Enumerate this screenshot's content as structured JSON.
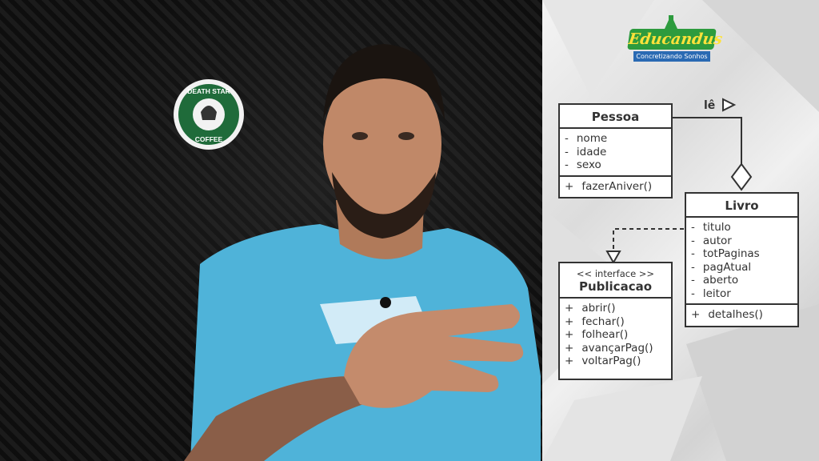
{
  "logo": {
    "name": "Educandus",
    "tagline": "Concretizando Sonhos"
  },
  "sticker": {
    "line1": "DEATH STAR",
    "line2": "COFFEE"
  },
  "diagram": {
    "association_label": "lê",
    "pessoa": {
      "title": "Pessoa",
      "attributes": [
        {
          "vis": "-",
          "name": "nome"
        },
        {
          "vis": "-",
          "name": "idade"
        },
        {
          "vis": "-",
          "name": "sexo"
        }
      ],
      "methods": [
        {
          "vis": "+",
          "name": "fazerAniver()"
        }
      ]
    },
    "livro": {
      "title": "Livro",
      "attributes": [
        {
          "vis": "-",
          "name": "titulo"
        },
        {
          "vis": "-",
          "name": "autor"
        },
        {
          "vis": "-",
          "name": "totPaginas"
        },
        {
          "vis": "-",
          "name": "pagAtual"
        },
        {
          "vis": "-",
          "name": "aberto"
        },
        {
          "vis": "-",
          "name": "leitor"
        }
      ],
      "methods": [
        {
          "vis": "+",
          "name": "detalhes()"
        }
      ]
    },
    "publicacao": {
      "stereotype": "<< interface >>",
      "title": "Publicacao",
      "methods": [
        {
          "vis": "+",
          "name": "abrir()"
        },
        {
          "vis": "+",
          "name": "fechar()"
        },
        {
          "vis": "+",
          "name": "folhear()"
        },
        {
          "vis": "+",
          "name": "avançarPag()"
        },
        {
          "vis": "+",
          "name": "voltarPag()"
        }
      ]
    }
  },
  "colors": {
    "shirt": "#4fb3d9",
    "logo_green": "#2d9b3e",
    "logo_blue": "#2a6ab3",
    "sticker_green": "#1f6b3a"
  }
}
